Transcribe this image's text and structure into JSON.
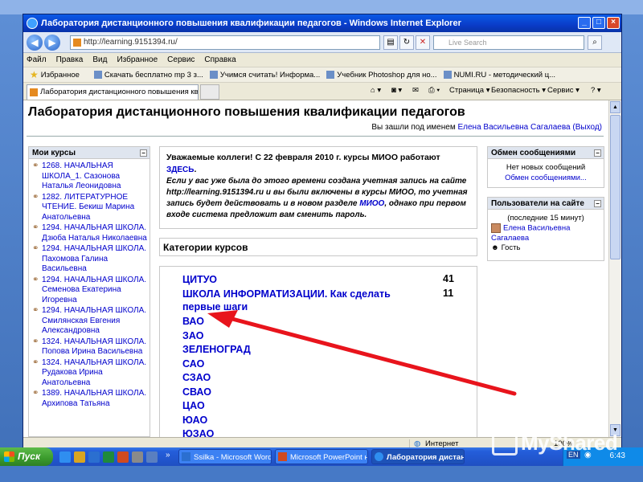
{
  "window": {
    "title": "Лаборатория дистанционного повышения квалификации педагогов - Windows Internet Explorer",
    "min": "_",
    "max": "□",
    "close": "×"
  },
  "address": {
    "url": "http://learning.9151394.ru/",
    "search_placeholder": "Live Search"
  },
  "menu": [
    "Файл",
    "Правка",
    "Вид",
    "Избранное",
    "Сервис",
    "Справка"
  ],
  "favorites": {
    "label": "Избранное",
    "items": [
      "Скачать бесплатно mp 3 з...",
      "Учимся считать! Информа...",
      "Учебник Photoshop для но...",
      "NUMI.RU - методический ц..."
    ]
  },
  "tab": {
    "label": "Лаборатория дистанционного повышения квалиф...",
    "commands": [
      "Страница ▾",
      "Безопасность ▾",
      "Сервис ▾"
    ]
  },
  "page": {
    "title": "Лаборатория дистанционного повышения квалификации педагогов",
    "login_prefix": "Вы зашли под именем",
    "login_user": "Елена Васильевна Сагалаева",
    "logout": "(Выход)"
  },
  "my_courses": {
    "title": "Мои курсы",
    "items": [
      "1268. НАЧАЛЬНАЯ ШКОЛА_1. Сазонова Наталья Леонидовна",
      "1282. ЛИТЕРАТУРНОЕ ЧТЕНИЕ. Бекиш Марина Анатольевна",
      "1294. НАЧАЛЬНАЯ ШКОЛА. Дзюба Наталья Николаевна",
      "1294. НАЧАЛЬНАЯ ШКОЛА. Пахомова Галина Васильевна",
      "1294. НАЧАЛЬНАЯ ШКОЛА. Семенова Екатерина Игоревна",
      "1294. НАЧАЛЬНАЯ ШКОЛА. Смилянская Евгения Александровна",
      "1324. НАЧАЛЬНАЯ ШКОЛА. Попова Ирина Васильевна",
      "1324. НАЧАЛЬНАЯ ШКОЛА. Рудакова Ирина Анатольевна",
      "1389. НАЧАЛЬНАЯ ШКОЛА. Архипова Татьяна"
    ]
  },
  "notice": {
    "line1": "Уважаемые коллеги! С 22 февраля 2010 г. курсы МИОО работают",
    "line1_link": "ЗДЕСЬ",
    "line2a": "Если у вас уже была до этого времени создана учетная запись на сайте http://learning.9151394.ru и вы были включены в курсы МИОО, то учетная запись будет действовать и в новом разделе",
    "line2_link": "МИОО",
    "line2b": ", однако при первом входе система предложит вам сменить пароль."
  },
  "categories": {
    "title": "Категории курсов",
    "items": [
      {
        "name": "ЦИТУО",
        "count": "41"
      },
      {
        "name": "ШКОЛА ИНФОРМАТИЗАЦИИ. Как сделать",
        "name2": "первые шаги",
        "count": "11"
      },
      {
        "name": "ВАО"
      },
      {
        "name": "ЗАО"
      },
      {
        "name": "ЗЕЛЕНОГРАД"
      },
      {
        "name": "САО"
      },
      {
        "name": "СЗАО"
      },
      {
        "name": "СВАО"
      },
      {
        "name": "ЦАО"
      },
      {
        "name": "ЮАО"
      },
      {
        "name": "ЮЗАО"
      }
    ]
  },
  "messages": {
    "title": "Обмен сообщениями",
    "none": "Нет новых сообщений",
    "link": "Обмен сообщениями..."
  },
  "online": {
    "title": "Пользователи на сайте",
    "period": "(последние 15 минут)",
    "user": "Елена Васильевна Сагалаева",
    "guest": "Гость"
  },
  "status": {
    "zone": "Интернет",
    "zoom": "100%"
  },
  "taskbar": {
    "start": "Пуск",
    "tasks": [
      "Ssilka - Microsoft Word н...",
      "Microsoft PowerPoint не...",
      "Лаборатория дистан..."
    ],
    "lang": "EN",
    "clock": "6:43"
  },
  "watermark": "MyShared",
  "colors": {
    "link": "#0000cc",
    "arrow": "#e8141c",
    "titlebar": "#0a3cc8"
  }
}
